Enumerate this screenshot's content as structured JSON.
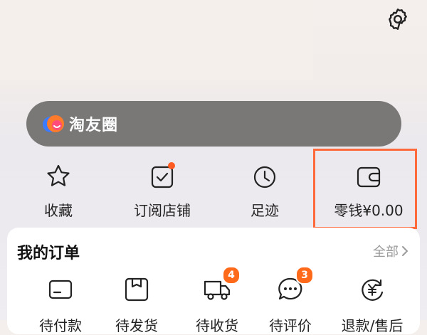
{
  "taoyou": {
    "label": "淘友圈"
  },
  "quick_actions": [
    {
      "label": "收藏",
      "icon": "star-icon"
    },
    {
      "label": "订阅店铺",
      "icon": "subscribe-check-icon"
    },
    {
      "label": "足迹",
      "icon": "clock-icon"
    },
    {
      "label": "零钱¥0.00",
      "icon": "wallet-icon"
    }
  ],
  "orders": {
    "title": "我的订单",
    "all_label": "全部",
    "items": [
      {
        "label": "待付款",
        "icon": "card-icon",
        "badge": ""
      },
      {
        "label": "待发货",
        "icon": "package-icon",
        "badge": ""
      },
      {
        "label": "待收货",
        "icon": "truck-icon",
        "badge": "4"
      },
      {
        "label": "待评价",
        "icon": "chat-icon",
        "badge": "3"
      },
      {
        "label": "退款/售后",
        "icon": "refund-icon",
        "badge": ""
      }
    ]
  },
  "colors": {
    "accent": "#ff6a1a",
    "highlight": "#ff6a3d",
    "pill": "#7a7877"
  }
}
